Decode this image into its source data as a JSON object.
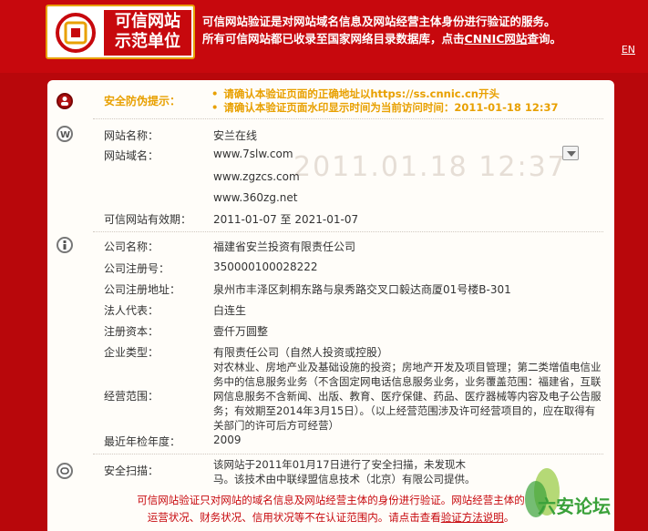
{
  "header": {
    "logo_text_line1": "可信网站",
    "logo_text_line2": "示范单位",
    "message_line1": "可信网站验证是对网站域名信息及网站经营主体身份进行验证的服务。",
    "message_line2_prefix": "所有可信网站都已收录至国家网络目录数据库，点击",
    "message_link": "CNNIC网站",
    "message_line2_suffix": "查询。",
    "lang_link": "EN"
  },
  "watermark": "2011.01.18 12:37",
  "safety": {
    "label": "安全防伪提示：",
    "tips": [
      "请确认本验证页面的正确地址以https://ss.cnnic.cn开头",
      "请确认本验证页面水印显示时间为当前访问时间：2011-01-18 12:37"
    ]
  },
  "website": {
    "name_label": "网站名称：",
    "name_value": "安兰在线",
    "domain_label": "网站域名：",
    "domains": [
      "www.7slw.com",
      "www.zgzcs.com",
      "www.360zg.net"
    ],
    "validity_label": "可信网站有效期：",
    "validity_value": "2011-01-07 至 2021-01-07"
  },
  "company": {
    "name_label": "公司名称：",
    "name_value": "福建省安兰投资有限责任公司",
    "reg_no_label": "公司注册号：",
    "reg_no_value": "350000100028222",
    "address_label": "公司注册地址：",
    "address_value": "泉州市丰泽区刺桐东路与泉秀路交叉口毅达商厦01号楼B-301",
    "legal_rep_label": "法人代表：",
    "legal_rep_value": "白连生",
    "capital_label": "注册资本：",
    "capital_value": "壹仟万圆整",
    "type_label": "企业类型：",
    "type_value": "有限责任公司（自然人投资或控股）",
    "scope_label": "经营范围：",
    "scope_value": "对农林业、房地产业及基础设施的投资；房地产开发及项目管理；第二类增值电信业务中的信息服务业务（不含固定网电话信息服务业务，业务覆盖范围：福建省，互联网信息服务不含新闻、出版、教育、医疗保健、药品、医疗器械等内容及电子公告服务；有效期至2014年3月15日）。（以上经营范围涉及许可经营项目的，应在取得有关部门的许可后方可经营）",
    "annual_label": "最近年检年度：",
    "annual_value": "2009"
  },
  "scan": {
    "label": "安全扫描：",
    "value": "该网站于2011年01月17日进行了安全扫描，未发现木马。该技术由中联绿盟信息技术（北京）有限公司提供。"
  },
  "footer": {
    "line1": "可信网站验证只对网站的域名信息及网站经营主体的身份进行验证。网站经营主体的",
    "line2_prefix": "运营状况、财务状况、信用状况等不在认证范围内。请点击查看",
    "line2_link": "验证方法说明",
    "line2_suffix": "。"
  },
  "forum_badge": "六安论坛",
  "colors": {
    "brand_red": "#c7080d",
    "notice_gold": "#e8a000",
    "card_bg": "#fffdf9"
  }
}
